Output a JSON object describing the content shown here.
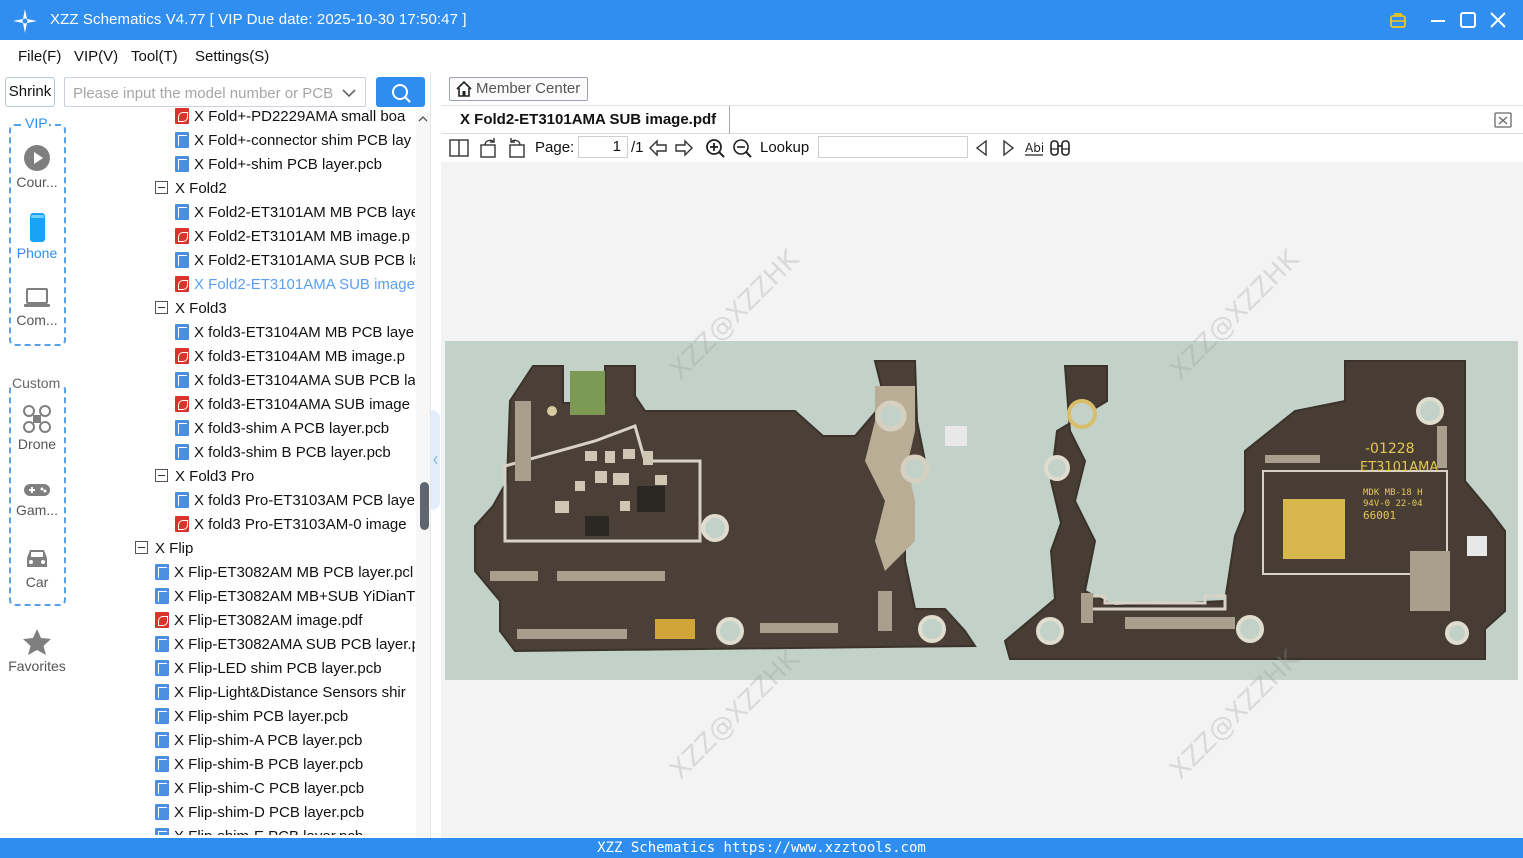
{
  "app": {
    "title": "XZZ Schematics V4.77 [ VIP Due date: 2025-10-30 17:50:47 ]"
  },
  "menu": [
    "File(F)",
    "VIP(V)",
    "Tool(T)",
    "Settings(S)"
  ],
  "search": {
    "shrink_label": "Shrink",
    "placeholder": "Please input the model number or PCB"
  },
  "sidebar": {
    "vip_group_label": "VIP",
    "custom_group_label": "Custom",
    "items": [
      {
        "label": "Cour...",
        "icon": "play-circle-icon",
        "active": false
      },
      {
        "label": "Phone",
        "icon": "phone-icon",
        "active": true
      },
      {
        "label": "Com...",
        "icon": "laptop-icon",
        "active": false
      },
      {
        "label": "Drone",
        "icon": "drone-icon",
        "active": false
      },
      {
        "label": "Gam...",
        "icon": "gamepad-icon",
        "active": false
      },
      {
        "label": "Car",
        "icon": "car-icon",
        "active": false
      },
      {
        "label": "Favorites",
        "icon": "star-icon",
        "active": false
      }
    ]
  },
  "tree": [
    {
      "level": 2,
      "type": "pdf",
      "label": "X Fold+-PD2229AMA small boa"
    },
    {
      "level": 2,
      "type": "pcb",
      "label": "X Fold+-connector shim PCB lay"
    },
    {
      "level": 2,
      "type": "pcb",
      "label": "X Fold+-shim PCB layer.pcb"
    },
    {
      "level": 1,
      "type": "folder",
      "label": "X Fold2"
    },
    {
      "level": 2,
      "type": "pcb",
      "label": "X Fold2-ET3101AM MB PCB laye"
    },
    {
      "level": 2,
      "type": "pdf",
      "label": "X Fold2-ET3101AM MB image.p"
    },
    {
      "level": 2,
      "type": "pcb",
      "label": "X Fold2-ET3101AMA SUB PCB la"
    },
    {
      "level": 2,
      "type": "pdf",
      "label": "X Fold2-ET3101AMA SUB image",
      "selected": true
    },
    {
      "level": 1,
      "type": "folder",
      "label": "X Fold3"
    },
    {
      "level": 2,
      "type": "pcb",
      "label": "X fold3-ET3104AM MB PCB laye"
    },
    {
      "level": 2,
      "type": "pdf",
      "label": "X fold3-ET3104AM MB image.p"
    },
    {
      "level": 2,
      "type": "pcb",
      "label": "X fold3-ET3104AMA SUB PCB la"
    },
    {
      "level": 2,
      "type": "pdf",
      "label": "X fold3-ET3104AMA SUB image"
    },
    {
      "level": 2,
      "type": "pcb",
      "label": "X fold3-shim A PCB layer.pcb"
    },
    {
      "level": 2,
      "type": "pcb",
      "label": "X fold3-shim B PCB layer.pcb"
    },
    {
      "level": 1,
      "type": "folder",
      "label": "X Fold3 Pro"
    },
    {
      "level": 2,
      "type": "pcb",
      "label": "X fold3 Pro-ET3103AM PCB laye"
    },
    {
      "level": 2,
      "type": "pdf",
      "label": "X fold3 Pro-ET3103AM-0 image"
    },
    {
      "level": 0,
      "type": "folder",
      "label": "X Flip"
    },
    {
      "level": 1,
      "type": "pcb",
      "label": "X Flip-ET3082AM MB PCB layer.pcl"
    },
    {
      "level": 1,
      "type": "pcb",
      "label": "X Flip-ET3082AM MB+SUB YiDianT"
    },
    {
      "level": 1,
      "type": "pdf",
      "label": "X Flip-ET3082AM image.pdf"
    },
    {
      "level": 1,
      "type": "pcb",
      "label": "X Flip-ET3082AMA SUB PCB layer.p"
    },
    {
      "level": 1,
      "type": "pcb",
      "label": "X Flip-LED shim PCB layer.pcb"
    },
    {
      "level": 1,
      "type": "pcb",
      "label": "X Flip-Light&Distance Sensors shir"
    },
    {
      "level": 1,
      "type": "pcb",
      "label": "X Flip-shim PCB layer.pcb"
    },
    {
      "level": 1,
      "type": "pcb",
      "label": "X Flip-shim-A PCB layer.pcb"
    },
    {
      "level": 1,
      "type": "pcb",
      "label": "X Flip-shim-B PCB layer.pcb"
    },
    {
      "level": 1,
      "type": "pcb",
      "label": "X Flip-shim-C PCB layer.pcb"
    },
    {
      "level": 1,
      "type": "pcb",
      "label": "X Flip-shim-D PCB layer.pcb"
    },
    {
      "level": 1,
      "type": "pcb",
      "label": "X Flip-shim-E PCB layer.pcb"
    }
  ],
  "viewer": {
    "member_center_label": "Member Center",
    "tab_title": "X Fold2-ET3101AMA SUB image.pdf",
    "page_label": "Page:",
    "page_value": "1",
    "page_total": "/1",
    "lookup_label": "Lookup",
    "lookup_value": "",
    "watermark": "XZZ@XZZHK",
    "board_text": {
      "part": "-01228",
      "model": "ET3101AMA",
      "mark1": "MDK MB-18 H",
      "mark2": "94V-0 22-04",
      "code": "66001"
    }
  },
  "status": {
    "text": "XZZ Schematics https://www.xzztools.com"
  },
  "colors": {
    "accent": "#2e8ef0",
    "selected_text": "#5aa0f0",
    "pdf_icon": "#d9342b",
    "pcb_icon": "#4a8fe0",
    "board_bg": "#c3d2c8",
    "pcb_dark": "#4a4038"
  }
}
